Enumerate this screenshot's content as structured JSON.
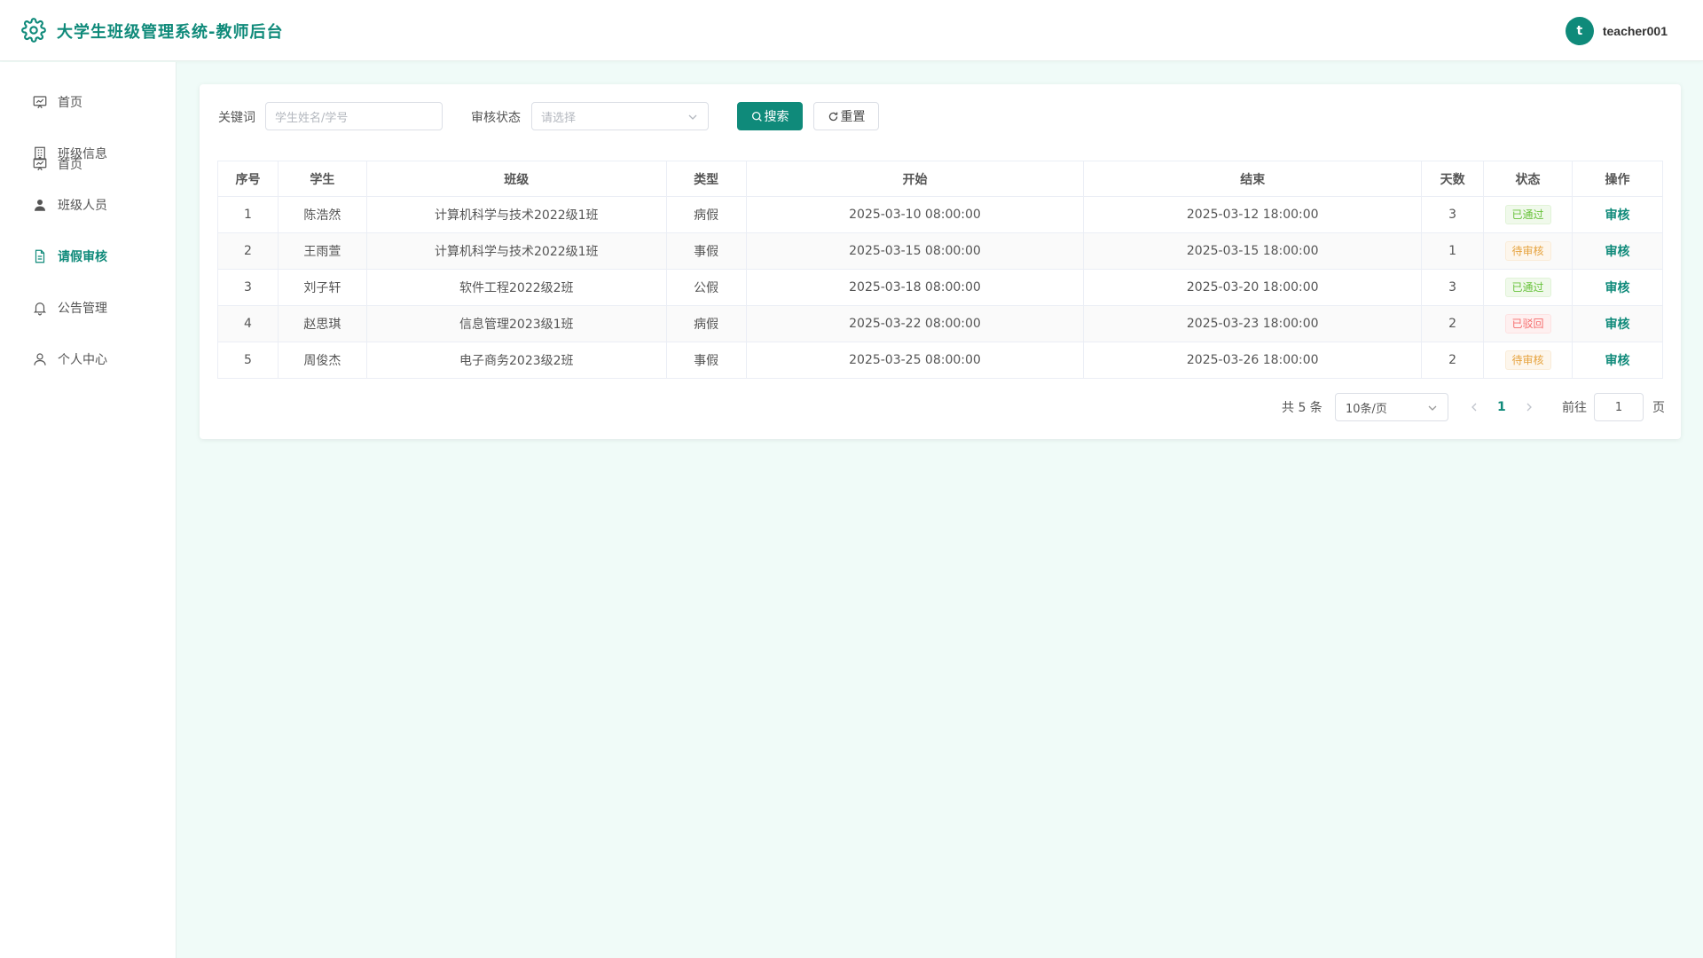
{
  "header": {
    "title": "大学生班级管理系统-教师后台",
    "user_initial": "t",
    "username": "teacher001"
  },
  "sidebar": {
    "items": [
      {
        "label": "首页",
        "icon": "dashboard-icon"
      },
      {
        "label": "班级信息",
        "icon": "building-icon"
      },
      {
        "label": "班级人员",
        "icon": "user-icon"
      },
      {
        "label": "请假审核",
        "icon": "document-icon",
        "active": true
      },
      {
        "label": "公告管理",
        "icon": "bell-icon"
      },
      {
        "label": "个人中心",
        "icon": "user-outline-icon"
      }
    ]
  },
  "filters": {
    "keyword_label": "关键词",
    "keyword_placeholder": "学生姓名/学号",
    "status_label": "审核状态",
    "status_placeholder": "请选择",
    "search_label": "搜索",
    "reset_label": "重置"
  },
  "table": {
    "headers": [
      "序号",
      "学生",
      "班级",
      "类型",
      "开始",
      "结束",
      "天数",
      "状态",
      "操作"
    ],
    "rows": [
      {
        "no": "1",
        "student": "陈浩然",
        "class": "计算机科学与技术2022级1班",
        "type": "病假",
        "start": "2025-03-10 08:00:00",
        "end": "2025-03-12 18:00:00",
        "days": "3",
        "status": "已通过",
        "action": "审核"
      },
      {
        "no": "2",
        "student": "王雨萱",
        "class": "计算机科学与技术2022级1班",
        "type": "事假",
        "start": "2025-03-15 08:00:00",
        "end": "2025-03-15 18:00:00",
        "days": "1",
        "status": "待审核",
        "action": "审核"
      },
      {
        "no": "3",
        "student": "刘子轩",
        "class": "软件工程2022级2班",
        "type": "公假",
        "start": "2025-03-18 08:00:00",
        "end": "2025-03-20 18:00:00",
        "days": "3",
        "status": "已通过",
        "action": "审核"
      },
      {
        "no": "4",
        "student": "赵思琪",
        "class": "信息管理2023级1班",
        "type": "病假",
        "start": "2025-03-22 08:00:00",
        "end": "2025-03-23 18:00:00",
        "days": "2",
        "status": "已驳回",
        "action": "审核"
      },
      {
        "no": "5",
        "student": "周俊杰",
        "class": "电子商务2023级2班",
        "type": "事假",
        "start": "2025-03-25 08:00:00",
        "end": "2025-03-26 18:00:00",
        "days": "2",
        "status": "待审核",
        "action": "审核"
      }
    ]
  },
  "pagination": {
    "total": "共 5 条",
    "page_size": "10条/页",
    "current_page": "1",
    "goto_label": "前往",
    "goto_value": "1",
    "page_suffix": "页"
  },
  "colors": {
    "accent": "#0f8a7a",
    "background": "#f0fbf8"
  }
}
